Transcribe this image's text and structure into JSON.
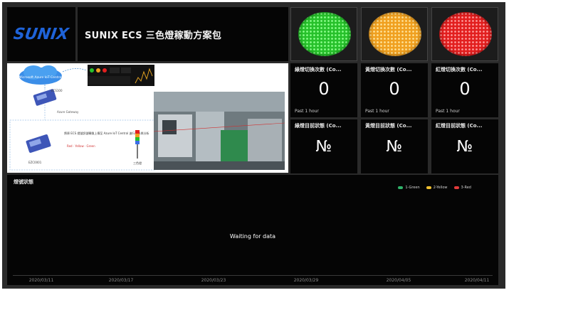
{
  "brand": {
    "logo_text": "SUNIX",
    "title": "SUNIX ECS 三色燈稼動方案包"
  },
  "lights": [
    {
      "name": "green-light",
      "color": "#27c12b"
    },
    {
      "name": "yellow-light",
      "color": "#f0a020"
    },
    {
      "name": "red-light",
      "color": "#e21f1f"
    }
  ],
  "diagram": {
    "cloud_label": "Microsoft Azure IoT Central",
    "device_top_label": "ECS100",
    "gateway_label": "Azure Gateway",
    "device_bottom_label": "EZC0001",
    "note_text": "將原 ECS 燈號訊號轉換上傳至 Azure IoT Central 進行統計與分析",
    "note_colors": "Red · Yellow · Green",
    "tower_label": "三色燈"
  },
  "stats": [
    {
      "title": "綠燈切換次數 (Co...",
      "value": "0",
      "sub": "Past 1 hour"
    },
    {
      "title": "黃燈切換次數 (Co...",
      "value": "0",
      "sub": "Past 1 hour"
    },
    {
      "title": "紅燈切換次數 (Co...",
      "value": "0",
      "sub": "Past 1 hour"
    }
  ],
  "no_data": [
    {
      "title": "綠燈目前狀態 (Co...",
      "value": "№"
    },
    {
      "title": "黃燈目前狀態 (Co...",
      "value": "№"
    },
    {
      "title": "紅燈目前狀態 (Co...",
      "value": "№"
    }
  ],
  "chart": {
    "title": "燈號狀態",
    "waiting": "Waiting for data",
    "legend": [
      {
        "label": "1-Green",
        "color": "#2fb36a"
      },
      {
        "label": "2-Yellow",
        "color": "#f0c030"
      },
      {
        "label": "3-Red",
        "color": "#e23b3b"
      }
    ],
    "x_ticks": [
      "2020/03/11",
      "2020/03/17",
      "2020/03/23",
      "2020/03/29",
      "2020/04/05",
      "2020/04/11"
    ]
  }
}
